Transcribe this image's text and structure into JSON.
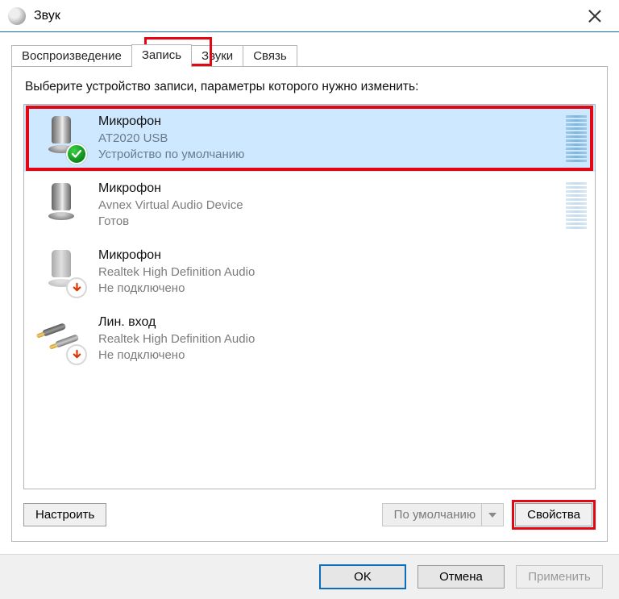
{
  "window": {
    "title": "Звук"
  },
  "tabs": [
    {
      "label": "Воспроизведение"
    },
    {
      "label": "Запись"
    },
    {
      "label": "Звуки"
    },
    {
      "label": "Связь"
    }
  ],
  "active_tab_index": 1,
  "instruction": "Выберите устройство записи, параметры которого нужно изменить:",
  "devices": [
    {
      "name": "Микрофон",
      "driver": "AT2020 USB",
      "status": "Устройство по умолчанию",
      "icon": "mic",
      "badge": "check",
      "selected": true,
      "meter": "strong"
    },
    {
      "name": "Микрофон",
      "driver": "Avnex Virtual Audio Device",
      "status": "Готов",
      "icon": "mic",
      "badge": "none",
      "selected": false,
      "meter": "faint"
    },
    {
      "name": "Микрофон",
      "driver": "Realtek High Definition Audio",
      "status": "Не подключено",
      "icon": "mic-disabled",
      "badge": "down",
      "selected": false,
      "meter": "none"
    },
    {
      "name": "Лин. вход",
      "driver": "Realtek High Definition Audio",
      "status": "Не подключено",
      "icon": "linein",
      "badge": "down",
      "selected": false,
      "meter": "none"
    }
  ],
  "panel_buttons": {
    "configure": "Настроить",
    "set_default": "По умолчанию",
    "properties": "Свойства"
  },
  "dialog_buttons": {
    "ok": "OK",
    "cancel": "Отмена",
    "apply": "Применить"
  },
  "highlights": {
    "tab_record": true,
    "first_device_row": true,
    "properties_button": true
  }
}
